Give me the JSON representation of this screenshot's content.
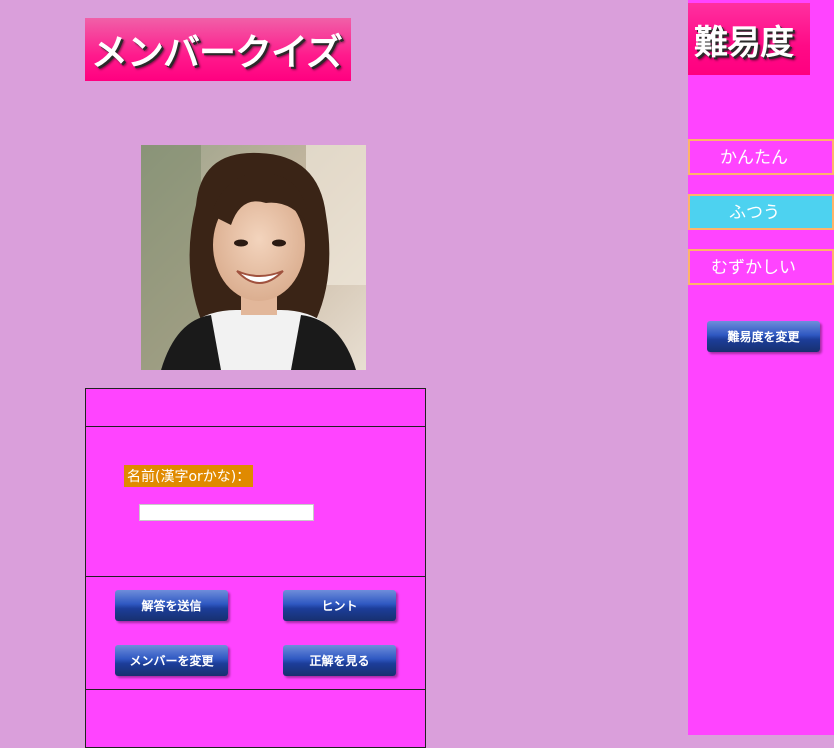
{
  "header": {
    "title": "メンバークイズ"
  },
  "photo": {
    "alt": "member photo"
  },
  "form": {
    "name_label": "名前(漢字orかな)：",
    "name_value": ""
  },
  "buttons": {
    "submit": "解答を送信",
    "hint": "ヒント",
    "change_member": "メンバーを変更",
    "show_answer": "正解を見る"
  },
  "sidebar": {
    "title": "難易度",
    "options": [
      {
        "label": "かんたん",
        "selected": false
      },
      {
        "label": "ふつう",
        "selected": true
      },
      {
        "label": "むずかしい",
        "selected": false
      }
    ],
    "change_button": "難易度を変更",
    "selected_color": "#4dd2f0"
  }
}
